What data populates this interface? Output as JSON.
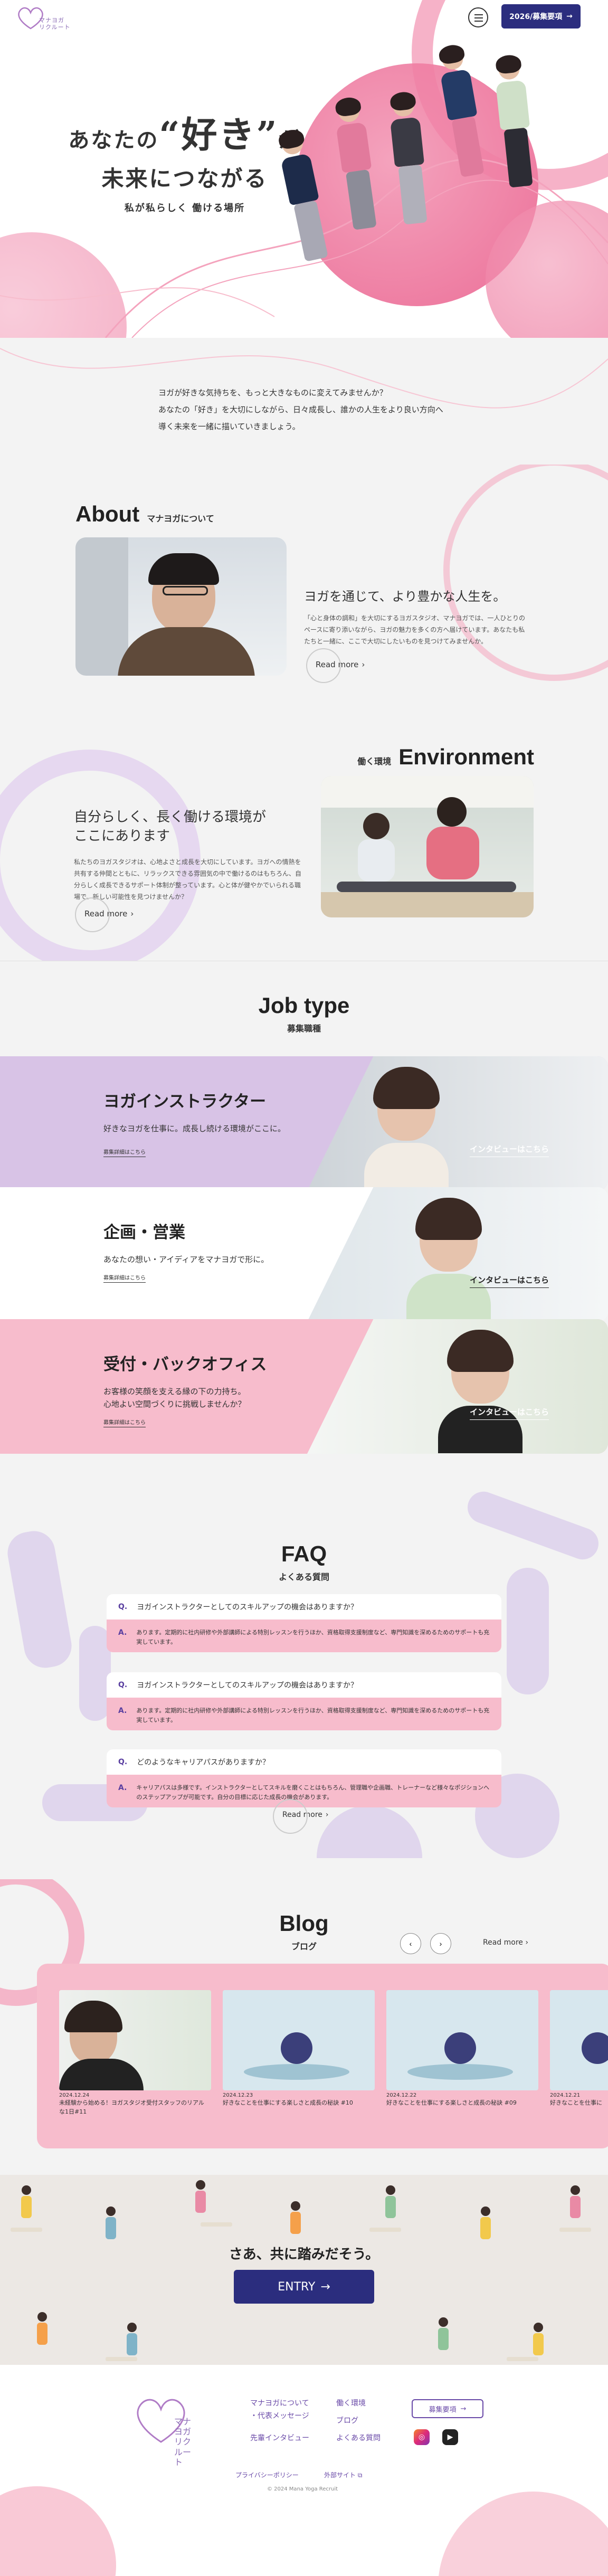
{
  "header": {
    "logo_line1": "マナヨガ",
    "logo_line2": "リクルート",
    "cta_label": "2026/募集要項",
    "cta_icon": "arrow-right-icon"
  },
  "hero": {
    "catch_pre": "あなたの",
    "catch_big": "“好き”",
    "catch_post": "が",
    "catch_line2": "未来につながる",
    "sub": "私が私らしく 働ける場所"
  },
  "intro": {
    "lines": [
      "ヨガが好きな気持ちを、もっと大きなものに変えてみませんか？",
      "あなたの「好き」を大切にしながら、日々成長し、誰かの人生をより良い方向へ",
      "導く未来を一緒に描いていきましょう。"
    ]
  },
  "about": {
    "title": "About",
    "subtitle": "マナヨガについて",
    "heading": "ヨガを通じて、より豊かな人生を。",
    "body": "「心と身体の調和」を大切にするヨガスタジオ、マナヨガでは、一人ひとりのペースに寄り添いながら、ヨガの魅力を多くの方へ届けています。あなたも私たちと一緒に、ここで大切にしたいものを見つけてみませんか。",
    "read_more": "Read more"
  },
  "environment": {
    "title": "Environment",
    "subtitle": "働く環境",
    "heading_line1": "自分らしく、長く働ける環境が",
    "heading_line2": "ここにあります",
    "body": "私たちのヨガスタジオは、心地よさと成長を大切にしています。ヨガへの情熱を共有する仲間とともに、リラックスできる雰囲気の中で働けるのはもちろん、自分らしく成長できるサポート体制が整っています。心と体が健やかでいられる職場で、新しい可能性を見つけませんか？",
    "read_more": "Read more"
  },
  "jobs": {
    "title": "Job type",
    "subtitle": "募集職種",
    "interview_label": "インタビューはこちら",
    "items": [
      {
        "title": "ヨガインストラクター",
        "desc_line1": "好きなヨガを仕事に。成長し続ける環境がここに。",
        "desc_line2": "",
        "link": "募集詳細はこちら",
        "bg": "#d8c3e6"
      },
      {
        "title": "企画・営業",
        "desc_line1": "あなたの想い・アイディアをマナヨガで形に。",
        "desc_line2": "",
        "link": "募集詳細はこちら",
        "bg": "#ffffff"
      },
      {
        "title": "受付・バックオフィス",
        "desc_line1": "お客様の笑顔を支える縁の下の力持ち。",
        "desc_line2": "心地よい空間づくりに挑戦しませんか？",
        "link": "募集詳細はこちら",
        "bg": "#f7bccc"
      }
    ]
  },
  "faq": {
    "title": "FAQ",
    "subtitle": "よくある質問",
    "q_mark": "Q.",
    "a_mark": "A.",
    "items": [
      {
        "q": "ヨガインストラクターとしてのスキルアップの機会はありますか？",
        "a": "あります。定期的に社内研修や外部講師による特別レッスンを行うほか、資格取得支援制度など、専門知識を深めるためのサポートも充実しています。"
      },
      {
        "q": "ヨガインストラクターとしてのスキルアップの機会はありますか？",
        "a": "あります。定期的に社内研修や外部講師による特別レッスンを行うほか、資格取得支援制度など、専門知識を深めるためのサポートも充実しています。"
      },
      {
        "q": "どのようなキャリアパスがありますか？",
        "a": "キャリアパスは多様です。インストラクターとしてスキルを磨くことはもちろん、管理職や企画職、トレーナーなど様々なポジションへのステップアップが可能です。自分の目標に応じた成長の機会があります。"
      }
    ],
    "read_more": "Read more"
  },
  "blog": {
    "title": "Blog",
    "subtitle": "ブログ",
    "prev_icon": "chevron-left-icon",
    "next_icon": "chevron-right-icon",
    "read_more": "Read more",
    "cards": [
      {
        "date": "2024.12.24",
        "title_line1": "未経験から始める！ヨガスタジオ受付スタッフのリアル",
        "title_line2": "な1日#11"
      },
      {
        "date": "2024.12.23",
        "title_line1": "好きなことを仕事にする楽しさと成長の秘訣 #10",
        "title_line2": ""
      },
      {
        "date": "2024.12.22",
        "title_line1": "好きなことを仕事にする楽しさと成長の秘訣 #09",
        "title_line2": ""
      },
      {
        "date": "2024.12.21",
        "title_line1": "好きなことを仕事に",
        "title_line2": ""
      }
    ]
  },
  "entry": {
    "catch": "さあ、共に踏みだそう。",
    "button": "ENTRY"
  },
  "footer": {
    "logo_line1": "マナヨガ",
    "logo_line2": "リクルート",
    "links_col1": [
      "マナヨガについて",
      "・代表メッセージ",
      "先輩インタビュー"
    ],
    "links_col2": [
      "働く環境",
      "ブログ",
      "よくある質問"
    ],
    "cta": "募集要項",
    "privacy": "プライバシーポリシー",
    "external": "外部サイト",
    "copyright": "© 2024 Mana Yoga Recruit"
  },
  "colors": {
    "pink": "#f07ea3",
    "light_pink": "#f7bccc",
    "lavender": "#d8c3e6",
    "navy": "#2b2d7e",
    "purple": "#6a4aa8"
  }
}
